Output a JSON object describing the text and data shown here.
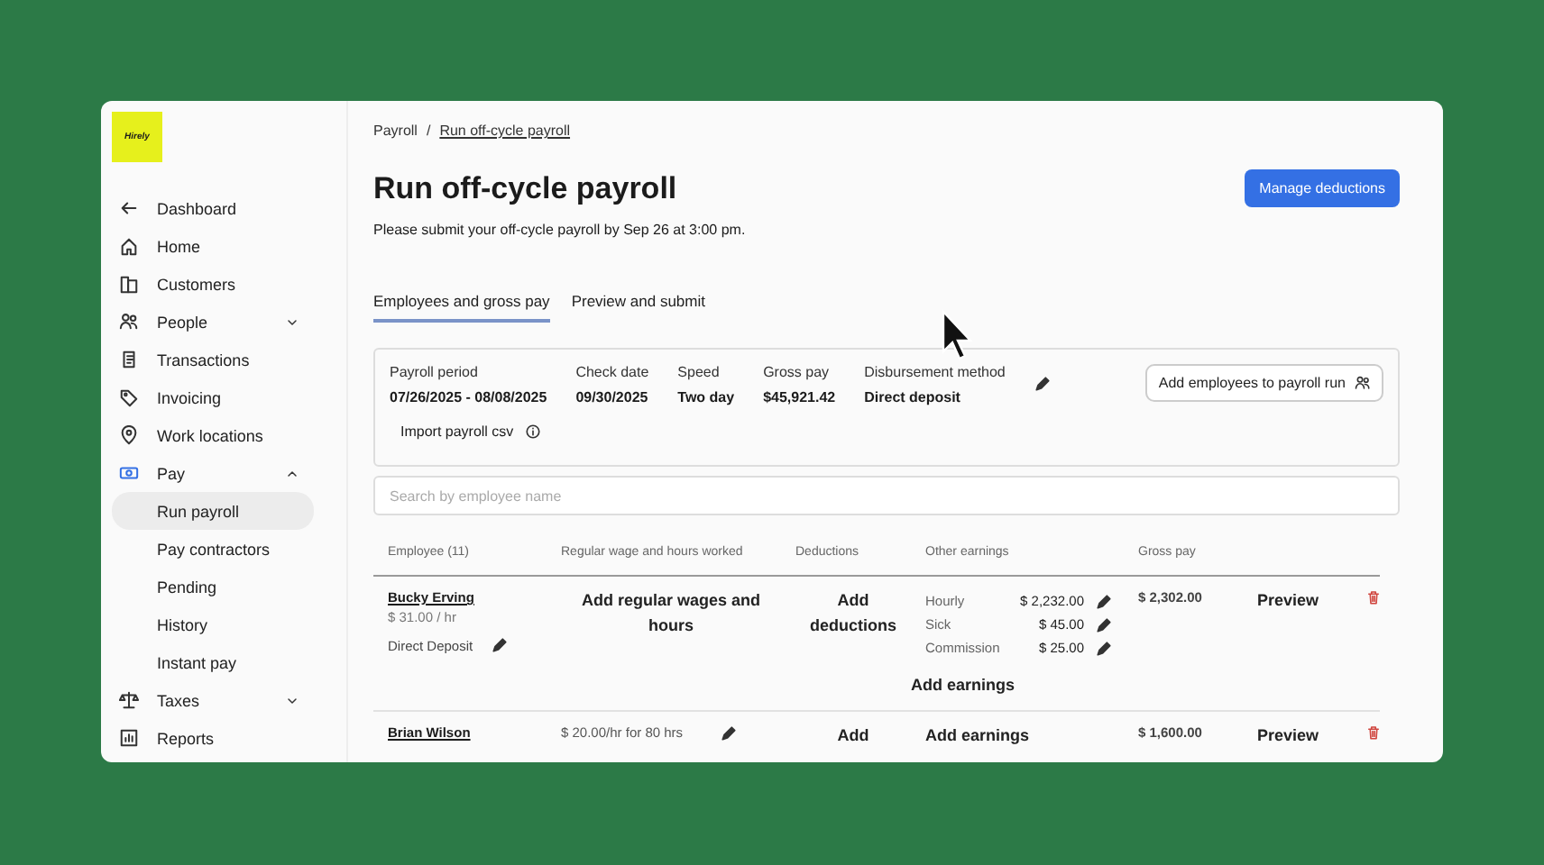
{
  "logo": {
    "text": "Hirely"
  },
  "sidebar": {
    "items": [
      {
        "kind": "link",
        "label": "Dashboard",
        "selected": false
      },
      {
        "kind": "link",
        "label": "Home",
        "selected": false
      },
      {
        "kind": "link",
        "label": "Customers",
        "selected": false
      },
      {
        "kind": "group",
        "label": "People",
        "selected": false,
        "expanded": false
      },
      {
        "kind": "link",
        "label": "Transactions",
        "selected": false
      },
      {
        "kind": "link",
        "label": "Invoicing",
        "selected": false
      },
      {
        "kind": "link",
        "label": "Work locations",
        "selected": false
      },
      {
        "kind": "group",
        "label": "Pay",
        "selected": false,
        "expanded": true,
        "children": [
          {
            "label": "Run payroll",
            "selected": true
          },
          {
            "label": "Pay contractors",
            "selected": false
          },
          {
            "label": "Pending",
            "selected": false
          },
          {
            "label": "History",
            "selected": false
          },
          {
            "label": "Instant pay",
            "selected": false
          }
        ]
      },
      {
        "kind": "group",
        "label": "Taxes",
        "selected": false,
        "expanded": false
      },
      {
        "kind": "link",
        "label": "Reports",
        "selected": false
      }
    ]
  },
  "breadcrumb": {
    "separator": "/",
    "items": [
      "Payroll",
      "Run off-cycle payroll"
    ]
  },
  "page": {
    "title": "Run off-cycle payroll",
    "subtitle": "Please submit your off-cycle payroll by Sep 26 at 3:00 pm.",
    "primary_button": "Manage deductions"
  },
  "tabs": [
    {
      "label": "Employees and gross pay",
      "selected": true
    },
    {
      "label": "Preview and submit",
      "selected": false
    }
  ],
  "summary": {
    "fields": [
      {
        "label": "Payroll period",
        "value": "07/26/2025 - 08/08/2025"
      },
      {
        "label": "Check date",
        "value": "09/30/2025"
      },
      {
        "label": "Speed",
        "value": "Two day"
      },
      {
        "label": "Gross pay",
        "value": "$45,921.42"
      },
      {
        "label": "Disbursement method",
        "value": "Direct deposit"
      }
    ],
    "add_button": "Add employees to payroll run",
    "import_label": "Import payroll csv"
  },
  "search": {
    "placeholder": "Search by employee name"
  },
  "table": {
    "columns": [
      "Employee (11)",
      "Regular wage and hours worked",
      "Deductions",
      "Other earnings",
      "Gross pay"
    ],
    "rows": [
      {
        "name": "Bucky Erving",
        "rate": "$ 31.00 / hr",
        "payment": "Direct Deposit",
        "regular": {
          "kind": "action",
          "text": "Add regular wages and hours"
        },
        "deductions": "Add deductions",
        "earnings": [
          {
            "label": "Hourly",
            "amount": "$ 2,232.00"
          },
          {
            "label": "Sick",
            "amount": "$ 45.00"
          },
          {
            "label": "Commission",
            "amount": "$ 25.00"
          }
        ],
        "add_earnings": "Add earnings",
        "gross": "$ 2,302.00",
        "action": "Preview"
      },
      {
        "name": "Brian Wilson",
        "regular": {
          "kind": "value",
          "text": "$ 20.00/hr for 80 hrs"
        },
        "deductions": "Add",
        "add_earnings": "Add earnings",
        "gross": "$ 1,600.00",
        "action": "Preview"
      }
    ]
  }
}
